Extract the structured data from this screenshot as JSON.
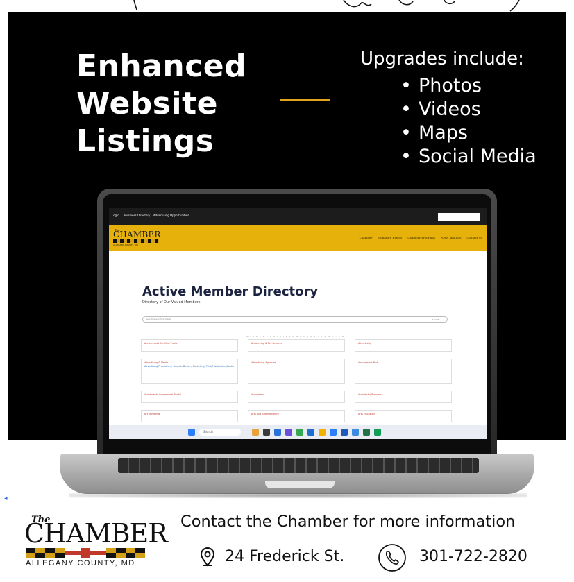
{
  "hero": {
    "title_lines": [
      "Enhanced",
      "Website",
      "Listings"
    ],
    "upgrades_title": "Upgrades include:",
    "upgrades": [
      "Photos",
      "Videos",
      "Maps",
      "Social Media"
    ],
    "accent_color": "#e2a41c",
    "background_color": "#000000"
  },
  "screen": {
    "topbar": {
      "login": "Login",
      "business_directory": "Business Directory",
      "advertising": "Advertising Opportunities"
    },
    "logo": {
      "the": "The",
      "name": "CHAMBER",
      "county": "ALLEGANY COUNTY, MD"
    },
    "nav": [
      "Chamber",
      "Signature Events",
      "Chamber Programs",
      "News and Info",
      "Contact Us"
    ],
    "nav_color": "#e7b10c",
    "directory_title": "Active Member Directory",
    "directory_subtitle": "Directory of Our Valued Members",
    "search_placeholder": "Search everything here!",
    "search_button": "Search",
    "alpha_row": "All A B C D E F G H I J K L M N O P Q R S T U V W X Y Z #",
    "categories": [
      {
        "label": "Accountants Certified Public",
        "sub": ""
      },
      {
        "label": "Accounting & Tax Services",
        "sub": ""
      },
      {
        "label": "Advertising",
        "sub": ""
      },
      {
        "label": "Advertising & Media",
        "sub": "Advertising/Promotions, Graphic Design, Marketing, Print/Publications/Radio"
      },
      {
        "label": "Advertising Agencies",
        "sub": ""
      },
      {
        "label": "Amusement Park",
        "sub": ""
      },
      {
        "label": "Apartments Commercial Rental",
        "sub": ""
      },
      {
        "label": "Appraisers",
        "sub": ""
      },
      {
        "label": "Architects/ Planners",
        "sub": ""
      },
      {
        "label": "Art Museums",
        "sub": ""
      },
      {
        "label": "Arts and Entertainment",
        "sub": ""
      },
      {
        "label": "Arts Education",
        "sub": ""
      }
    ],
    "taskbar_search": "Search"
  },
  "footer": {
    "logo": {
      "the": "The",
      "name": "CHAMBER",
      "county": "ALLEGANY COUNTY, MD"
    },
    "contact_title": "Contact the Chamber for more information",
    "address": "24 Frederick St.",
    "phone": "301-722-2820",
    "pin_icon": "location-pin-icon",
    "phone_icon": "phone-icon"
  }
}
